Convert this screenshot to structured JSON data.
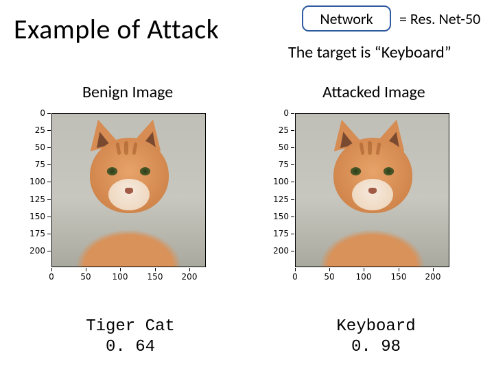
{
  "title": "Example of Attack",
  "network_box_label": "Network",
  "network_equals": "=  Res. Net-50",
  "target_line": "The target is “Keyboard”",
  "columns": {
    "left_title": "Benign Image",
    "right_title": "Attacked Image"
  },
  "chart_data": [
    {
      "type": "image-with-axes",
      "label": "Benign Image",
      "x_ticks": [
        0,
        50,
        100,
        150,
        200
      ],
      "y_ticks": [
        0,
        25,
        50,
        75,
        100,
        125,
        150,
        175,
        200
      ],
      "xlim": [
        0,
        224
      ],
      "ylim": [
        224,
        0
      ],
      "image_subject": "orange tabby cat, frontal, neutral grey background",
      "classification": {
        "label": "Tiger Cat",
        "confidence": 0.64
      }
    },
    {
      "type": "image-with-axes",
      "label": "Attacked Image",
      "x_ticks": [
        0,
        50,
        100,
        150,
        200
      ],
      "y_ticks": [
        0,
        25,
        50,
        75,
        100,
        125,
        150,
        175,
        200
      ],
      "xlim": [
        0,
        224
      ],
      "ylim": [
        224,
        0
      ],
      "image_subject": "orange tabby cat (adversarially perturbed, visually near-identical)",
      "classification": {
        "label": "Keyboard",
        "confidence": 0.98
      }
    }
  ],
  "captions": {
    "left": {
      "line1": "Tiger Cat",
      "line2": "0. 64"
    },
    "right": {
      "line1": "Keyboard",
      "line2": "0. 98"
    }
  }
}
